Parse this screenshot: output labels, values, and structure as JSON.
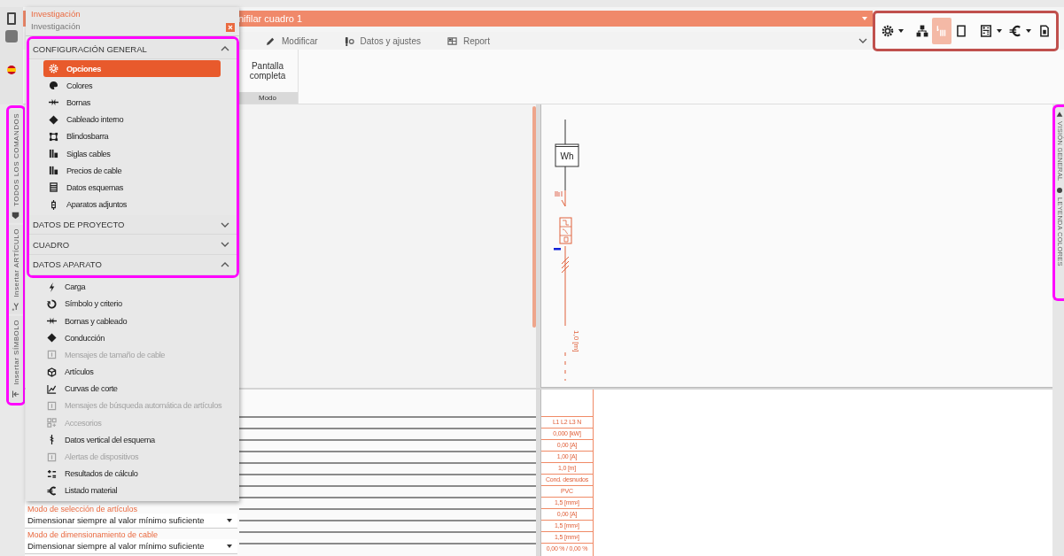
{
  "header": {
    "title": "nifilar cuadro 1",
    "ribbon_tabs": [
      {
        "label": "Modificar"
      },
      {
        "label": "Datos y ajustes"
      },
      {
        "label": "Report"
      }
    ],
    "ribbon_group": {
      "button": "Pantalla completa",
      "caption": "Modo"
    }
  },
  "toolbar": {
    "settings_button": {
      "dropdown": true
    },
    "view_toggles": [
      {
        "selected": false
      },
      {
        "selected": true
      },
      {
        "selected": false
      }
    ],
    "action_buttons": [
      {
        "dropdown": true
      },
      {
        "dropdown": true
      },
      {
        "dropdown": false
      }
    ]
  },
  "left_tabs": [
    {
      "label": "TODOS LOS COMANDOS"
    },
    {
      "label": "Insertar ARTÍCULO"
    },
    {
      "label": "Insertar SÍMBOLO"
    }
  ],
  "right_tabs": [
    {
      "label": "VISIÓN GENERAL"
    },
    {
      "label": "LEYENDA COLORES"
    }
  ],
  "popup": {
    "title": "Investigación",
    "subtitle": "Investigación",
    "sections": [
      {
        "title": "CONFIGURACIÓN GENERAL",
        "expanded": true,
        "items": [
          {
            "label": "Opciones",
            "selected": true,
            "disabled": false
          },
          {
            "label": "Colores",
            "selected": false,
            "disabled": false
          },
          {
            "label": "Bornas",
            "selected": false,
            "disabled": false
          },
          {
            "label": "Cableado interno",
            "selected": false,
            "disabled": false
          },
          {
            "label": "Blindosbarra",
            "selected": false,
            "disabled": false
          },
          {
            "label": "Siglas cables",
            "selected": false,
            "disabled": false
          },
          {
            "label": "Precios de cable",
            "selected": false,
            "disabled": false
          },
          {
            "label": "Datos esquemas",
            "selected": false,
            "disabled": false
          },
          {
            "label": "Aparatos adjuntos",
            "selected": false,
            "disabled": false
          }
        ]
      },
      {
        "title": "DATOS DE PROYECTO",
        "expanded": false
      },
      {
        "title": "CUADRO",
        "expanded": false
      },
      {
        "title": "DATOS APARATO",
        "expanded": true,
        "items": [
          {
            "label": "Carga",
            "selected": false,
            "disabled": false
          },
          {
            "label": "Símbolo y criterio",
            "selected": false,
            "disabled": false
          },
          {
            "label": "Bornas y cableado",
            "selected": false,
            "disabled": false
          },
          {
            "label": "Conducción",
            "selected": false,
            "disabled": false
          },
          {
            "label": "Mensajes de tamaño de cable",
            "selected": false,
            "disabled": true
          },
          {
            "label": "Artículos",
            "selected": false,
            "disabled": false
          },
          {
            "label": "Curvas de corte",
            "selected": false,
            "disabled": false
          },
          {
            "label": "Mensajes de búsqueda automática de artículos",
            "selected": false,
            "disabled": true
          },
          {
            "label": "Accesorios",
            "selected": false,
            "disabled": true
          },
          {
            "label": "Datos vertical del esquema",
            "selected": false,
            "disabled": false
          },
          {
            "label": "Alertas de dispositivos",
            "selected": false,
            "disabled": true
          },
          {
            "label": "Resultados de cálculo",
            "selected": false,
            "disabled": false
          },
          {
            "label": "Listado material",
            "selected": false,
            "disabled": false
          }
        ]
      }
    ]
  },
  "diagram": {
    "meter_label": "Wh",
    "length_label": "1,0 [m]"
  },
  "values_column": [
    "L1 L2 L3 N",
    "0,000 [kW]",
    "0,00 [A]",
    "1,00 [A]",
    "1,0 [m]",
    "Cond. desnudos",
    "PVC",
    "1,5 [mm²]",
    "0,00 [A]",
    "1,5 [mm²]",
    "1,5 [mm²]",
    "0,00 % / 0,00 %"
  ],
  "properties": [
    {
      "label": "Modo de selección de artículos",
      "value": "Dimensionar siempre al valor mínimo suficiente"
    },
    {
      "label": "Modo de dimensionamiento de cable",
      "value": "Dimensionar siempre al valor mínimo suficiente"
    }
  ]
}
